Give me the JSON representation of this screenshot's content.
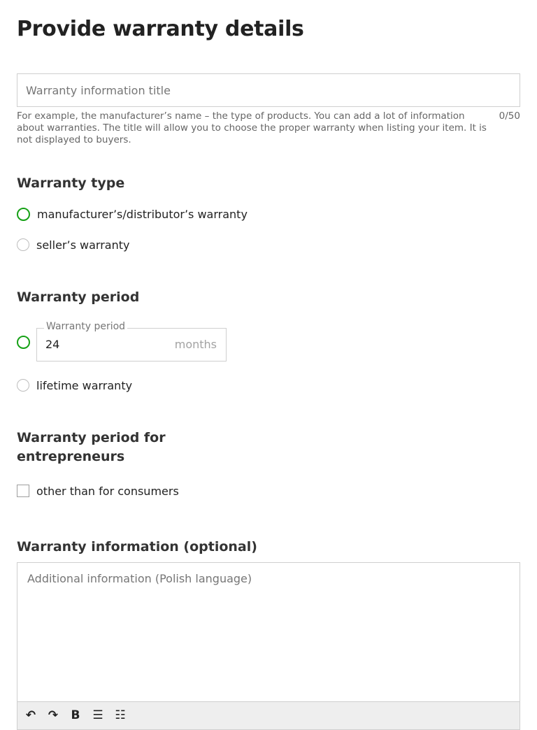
{
  "page": {
    "title": "Provide warranty details"
  },
  "title_field": {
    "placeholder": "Warranty information title",
    "value": "",
    "helper": "For example, the manufacturer’s name – the type of products. You can add a lot of information about warranties. The title will allow you to choose the proper warranty when listing your item. It is not displayed to buyers.",
    "counter": "0/50"
  },
  "warranty_type": {
    "heading": "Warranty type",
    "options": [
      {
        "label": "manufacturer’s/distributor’s warranty"
      },
      {
        "label": "seller’s warranty"
      }
    ]
  },
  "warranty_period": {
    "heading": "Warranty period",
    "field_label": "Warranty period",
    "value": "24",
    "unit": "months",
    "lifetime_label": "lifetime warranty"
  },
  "entrepreneurs": {
    "heading_line1": "Warranty period for",
    "heading_line2": "entrepreneurs",
    "checkbox_label": "other than for consumers"
  },
  "info": {
    "heading": "Warranty information (optional)",
    "placeholder": "Additional information (Polish language)"
  },
  "toolbar": {
    "undo_icon": "↶",
    "redo_icon": "↷",
    "bold_label": "B",
    "bullet_list_icon": "☰",
    "numbered_list_icon": "☷"
  },
  "colors": {
    "accent": "#16a116",
    "border": "#cfcfcf",
    "muted": "#767676"
  }
}
